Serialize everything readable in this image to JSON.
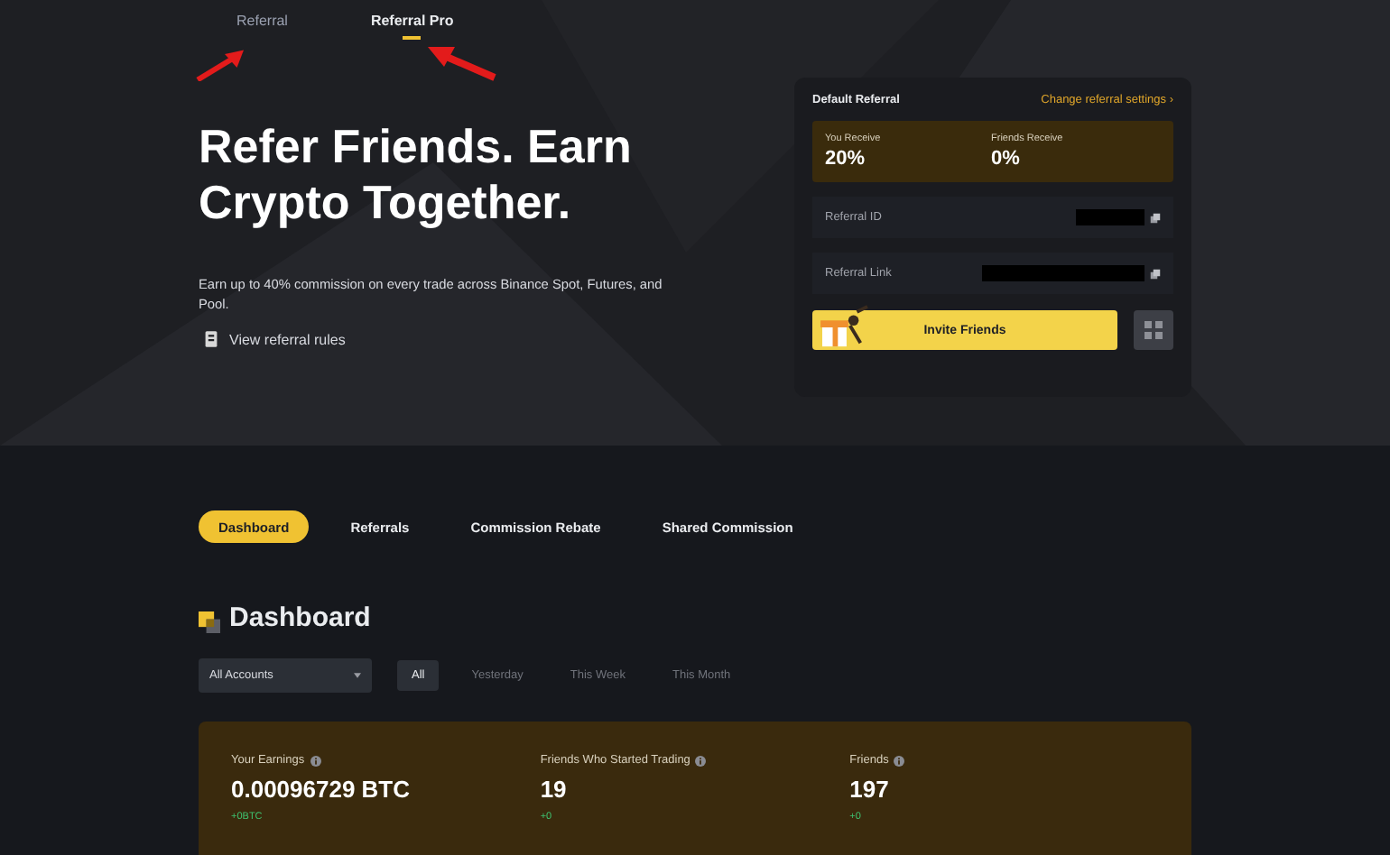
{
  "nav": {
    "tabs": [
      {
        "label": "Referral",
        "selected": false
      },
      {
        "label": "Referral Pro",
        "selected": true
      }
    ]
  },
  "hero": {
    "title": "Refer Friends. Earn Crypto Together.",
    "description": "Earn up to 40% commission on every trade across Binance Spot, Futures, and Pool.",
    "rules_link": "View referral rules"
  },
  "referral_card": {
    "title": "Default Referral",
    "settings_link": "Change referral settings",
    "settings_chevron": "›",
    "rates": [
      {
        "label": "You Receive",
        "value": "20%"
      },
      {
        "label": "Friends Receive",
        "value": "0%"
      }
    ],
    "fields": [
      {
        "label": "Referral ID",
        "redacted": true
      },
      {
        "label": "Referral Link",
        "redacted": true
      }
    ],
    "invite_button": "Invite Friends"
  },
  "section_tabs": [
    {
      "label": "Dashboard",
      "selected": true
    },
    {
      "label": "Referrals",
      "selected": false
    },
    {
      "label": "Commission Rebate",
      "selected": false
    },
    {
      "label": "Shared Commission",
      "selected": false
    }
  ],
  "dashboard": {
    "title": "Dashboard",
    "account_select": "All Accounts",
    "periods": [
      {
        "label": "All",
        "selected": true
      },
      {
        "label": "Yesterday",
        "selected": false
      },
      {
        "label": "This Week",
        "selected": false
      },
      {
        "label": "This Month",
        "selected": false
      }
    ],
    "stats": [
      {
        "label": "Your Earnings",
        "value": "0.00096729 BTC",
        "change": "+0BTC"
      },
      {
        "label": "Friends Who Started Trading",
        "value": "19",
        "change": "+0"
      },
      {
        "label": "Friends",
        "value": "197",
        "change": "+0"
      }
    ]
  }
}
